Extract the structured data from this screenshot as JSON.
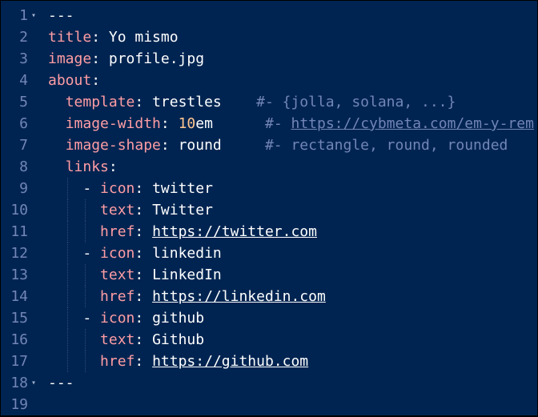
{
  "editor": {
    "fold_glyph": "▾",
    "lines": [
      {
        "n": "1",
        "fold": true,
        "parts": [
          {
            "t": "---",
            "c": "dash"
          }
        ]
      },
      {
        "n": "2",
        "parts": [
          {
            "t": "title",
            "c": "key"
          },
          {
            "t": ": Yo mismo"
          }
        ]
      },
      {
        "n": "3",
        "parts": [
          {
            "t": "image",
            "c": "key"
          },
          {
            "t": ": profile.jpg"
          }
        ]
      },
      {
        "n": "4",
        "parts": [
          {
            "t": "about",
            "c": "key"
          },
          {
            "t": ":"
          }
        ]
      },
      {
        "n": "5",
        "parts": [
          {
            "t": "  "
          },
          {
            "t": "template",
            "c": "key"
          },
          {
            "t": ": trestles    "
          },
          {
            "t": "#- {jolla, solana, ...}",
            "c": "comment"
          }
        ]
      },
      {
        "n": "6",
        "parts": [
          {
            "t": "  "
          },
          {
            "t": "image-width",
            "c": "key"
          },
          {
            "t": ": "
          },
          {
            "t": "10",
            "c": "num"
          },
          {
            "t": "em      "
          },
          {
            "t": "#- ",
            "c": "comment"
          },
          {
            "t": "https://cybmeta.com/em-y-rem",
            "c": "comment link"
          }
        ]
      },
      {
        "n": "7",
        "parts": [
          {
            "t": "  "
          },
          {
            "t": "image-shape",
            "c": "key"
          },
          {
            "t": ": round     "
          },
          {
            "t": "#- rectangle, round, rounded",
            "c": "comment"
          }
        ]
      },
      {
        "n": "8",
        "parts": [
          {
            "t": "  "
          },
          {
            "t": "links",
            "c": "key"
          },
          {
            "t": ":"
          }
        ]
      },
      {
        "n": "9",
        "guides": 1,
        "parts": [
          {
            "t": "    - "
          },
          {
            "t": "icon",
            "c": "key"
          },
          {
            "t": ": twitter"
          }
        ]
      },
      {
        "n": "10",
        "guides": 2,
        "parts": [
          {
            "t": "      "
          },
          {
            "t": "text",
            "c": "key"
          },
          {
            "t": ": Twitter"
          }
        ]
      },
      {
        "n": "11",
        "guides": 2,
        "parts": [
          {
            "t": "      "
          },
          {
            "t": "href",
            "c": "key"
          },
          {
            "t": ": "
          },
          {
            "t": "https://twitter.com",
            "c": "link"
          }
        ]
      },
      {
        "n": "12",
        "guides": 1,
        "parts": [
          {
            "t": "    - "
          },
          {
            "t": "icon",
            "c": "key"
          },
          {
            "t": ": linkedin"
          }
        ]
      },
      {
        "n": "13",
        "guides": 2,
        "parts": [
          {
            "t": "      "
          },
          {
            "t": "text",
            "c": "key"
          },
          {
            "t": ": LinkedIn"
          }
        ]
      },
      {
        "n": "14",
        "guides": 2,
        "parts": [
          {
            "t": "      "
          },
          {
            "t": "href",
            "c": "key"
          },
          {
            "t": ": "
          },
          {
            "t": "https://linkedin.com",
            "c": "link"
          }
        ]
      },
      {
        "n": "15",
        "guides": 1,
        "parts": [
          {
            "t": "    - "
          },
          {
            "t": "icon",
            "c": "key"
          },
          {
            "t": ": github"
          }
        ]
      },
      {
        "n": "16",
        "guides": 2,
        "parts": [
          {
            "t": "      "
          },
          {
            "t": "text",
            "c": "key"
          },
          {
            "t": ": Github"
          }
        ]
      },
      {
        "n": "17",
        "guides": 2,
        "parts": [
          {
            "t": "      "
          },
          {
            "t": "href",
            "c": "key"
          },
          {
            "t": ": "
          },
          {
            "t": "https://github.com",
            "c": "link"
          }
        ]
      },
      {
        "n": "18",
        "fold": true,
        "parts": [
          {
            "t": "---",
            "c": "dash"
          }
        ]
      },
      {
        "n": "19",
        "parts": []
      }
    ]
  },
  "colors": {
    "background": "#002451",
    "line_number": "#7285b7",
    "key": "#ff9da4",
    "text": "#ffffff",
    "number": "#ffc58f",
    "comment": "#7285b7"
  }
}
